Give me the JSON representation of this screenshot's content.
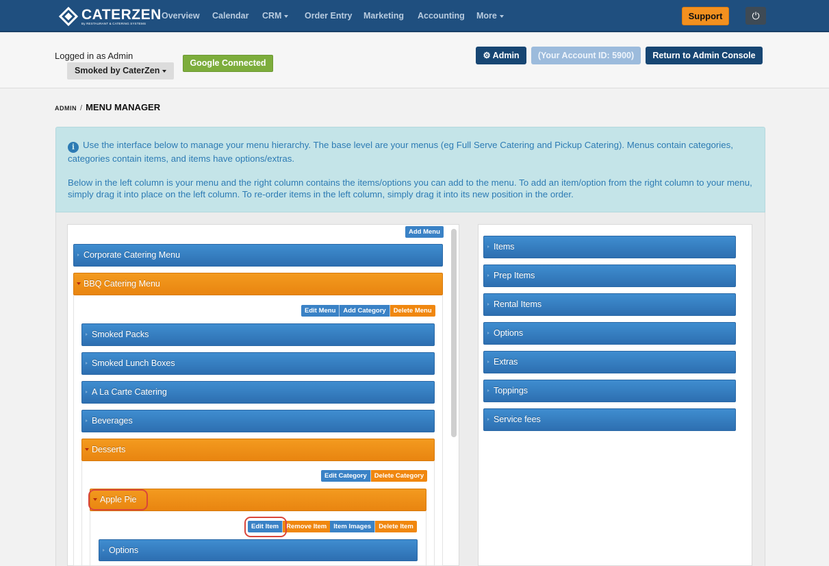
{
  "brand": {
    "name": "CATERZEN",
    "tagline": "By RESTAURANT & CATERING SYSTEMS"
  },
  "nav": {
    "items": [
      {
        "label": "Overview"
      },
      {
        "label": "Calendar"
      },
      {
        "label": "CRM",
        "dropdown": true
      },
      {
        "label": "Order Entry"
      },
      {
        "label": "Marketing"
      },
      {
        "label": "Accounting"
      },
      {
        "label": "More",
        "dropdown": true
      }
    ],
    "support_label": "Support",
    "power_icon": "power-icon"
  },
  "account": {
    "logged_in_text": "Logged in as Admin",
    "org_label": "Smoked by CaterZen",
    "google_label": "Google Connected",
    "admin_label": "Admin",
    "account_id_label": "(Your Account ID: 5900)",
    "return_label": "Return to Admin Console"
  },
  "breadcrumb": {
    "root": "ADMIN",
    "separator": "/",
    "current": "MENU MANAGER"
  },
  "info": {
    "p1": "Use the interface below to manage your menu hierarchy. The base level are your menus (eg Full Serve Catering and Pickup Catering). Menus contain categories, categories contain items, and items have options/extras.",
    "p2": "Below in the left column is your menu and the right column contains the items/options you can add to the menu. To add an item/option from the right column to your menu, simply drag it into place on the left column. To re-order items in the left column, simply drag it into its new position in the order."
  },
  "left": {
    "add_menu_label": "Add Menu",
    "menus": [
      {
        "label": "Corporate Catering Menu",
        "expanded": false
      },
      {
        "label": "BBQ Catering Menu",
        "expanded": true
      }
    ],
    "menu_actions": [
      "Edit Menu",
      "Add Category",
      "Delete Menu"
    ],
    "categories": [
      {
        "label": "Smoked Packs"
      },
      {
        "label": "Smoked Lunch Boxes"
      },
      {
        "label": "A La Carte Catering"
      },
      {
        "label": "Beverages"
      },
      {
        "label": "Desserts",
        "expanded": true
      }
    ],
    "category_actions": [
      "Edit Category",
      "Delete Category"
    ],
    "item": {
      "label": "Apple Pie"
    },
    "item_actions": [
      "Edit Item",
      "Remove Item",
      "Item Images",
      "Delete Item"
    ],
    "item_children": [
      {
        "label": "Options"
      }
    ]
  },
  "right": {
    "items": [
      {
        "label": "Items"
      },
      {
        "label": "Prep Items"
      },
      {
        "label": "Rental Items"
      },
      {
        "label": "Options"
      },
      {
        "label": "Extras"
      },
      {
        "label": "Toppings"
      },
      {
        "label": "Service fees"
      }
    ]
  },
  "colors": {
    "nav_bg": "#1f4f7f",
    "accent_orange": "#f0870f",
    "accent_blue": "#2d6fb1",
    "highlight": "#d9453a"
  }
}
